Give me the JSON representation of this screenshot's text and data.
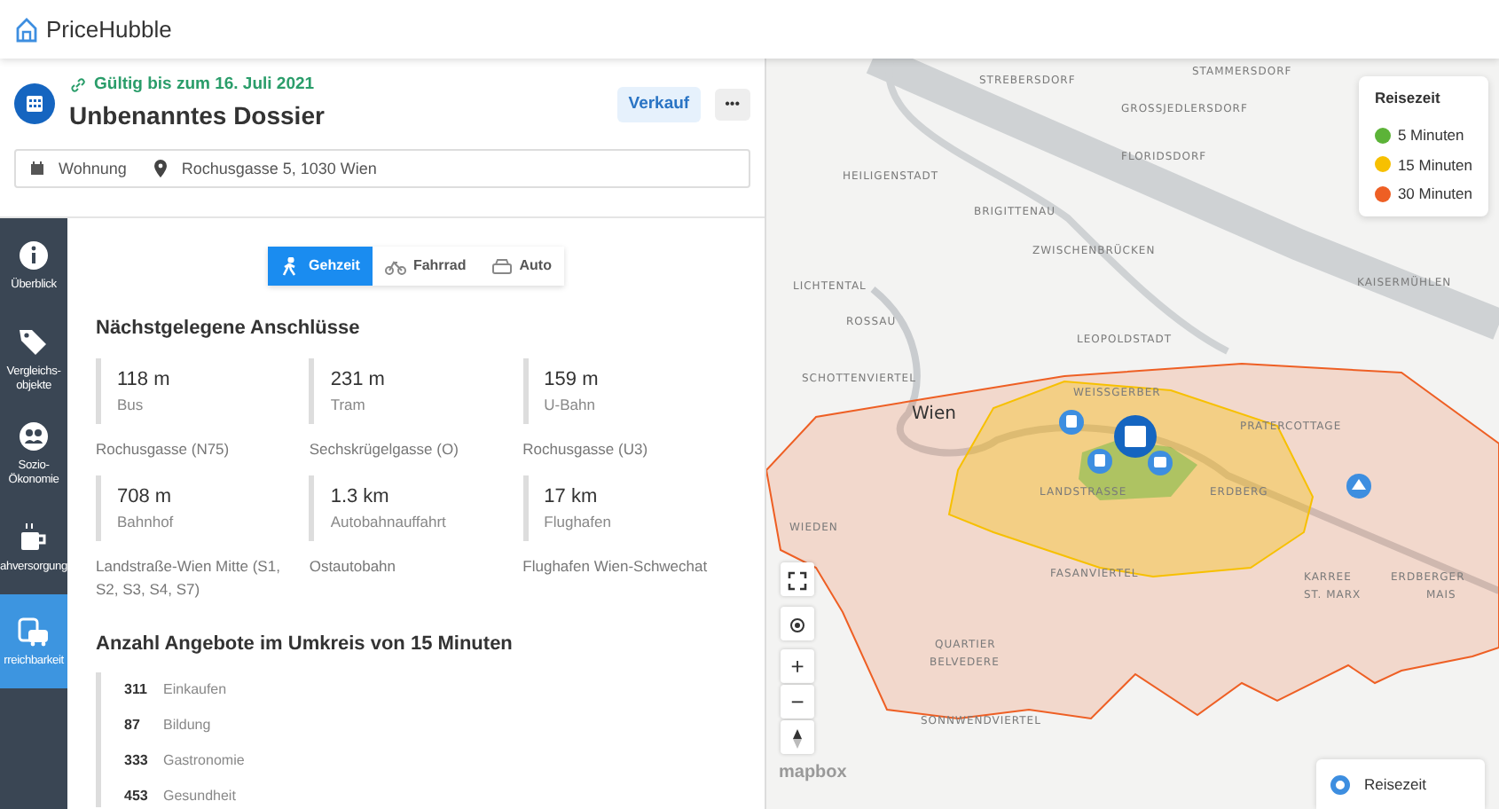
{
  "app": {
    "brand": "PriceHubble"
  },
  "dossier": {
    "validity": "Gültig bis zum 16. Juli 2021",
    "title": "Unbenanntes Dossier",
    "deal_type": "Verkauf",
    "more": "•••",
    "property_type": "Wohnung",
    "address": "Rochusgasse 5, 1030 Wien"
  },
  "sidebar": {
    "items": [
      {
        "kind": "info",
        "label": "Überblick",
        "selected": false
      },
      {
        "kind": "tags",
        "label": "Vergleichs-objekte",
        "selected": false
      },
      {
        "kind": "people",
        "label": "Sozio-Ökonomie",
        "selected": false
      },
      {
        "kind": "cup",
        "label": "ahversorgung",
        "selected": false
      },
      {
        "kind": "transit",
        "label": "rreichbarkeit",
        "selected": true
      }
    ]
  },
  "mode_tabs": [
    {
      "kind": "walk",
      "label": "Gehzeit",
      "selected": true
    },
    {
      "kind": "bike",
      "label": "Fahrrad",
      "selected": false
    },
    {
      "kind": "car",
      "label": "Auto",
      "selected": false
    }
  ],
  "connections": {
    "title": "Nächstgelegene Anschlüsse",
    "items": [
      {
        "distance": "118 m",
        "type": "Bus",
        "name": "Rochusgasse (N75)"
      },
      {
        "distance": "231 m",
        "type": "Tram",
        "name": "Sechskrügelgasse (O)"
      },
      {
        "distance": "159 m",
        "type": "U-Bahn",
        "name": "Rochusgasse (U3)"
      },
      {
        "distance": "708 m",
        "type": "Bahnhof",
        "name": "Landstraße-Wien Mitte (S1, S2, S3, S4, S7)"
      },
      {
        "distance": "1.3 km",
        "type": "Autobahnauffahrt",
        "name": "Ostautobahn"
      },
      {
        "distance": "17 km",
        "type": "Flughafen",
        "name": "Flughafen Wien-Schwechat"
      }
    ]
  },
  "offers": {
    "title": "Anzahl Angebote im Umkreis von 15 Minuten",
    "items": [
      {
        "count": "311",
        "label": "Einkaufen"
      },
      {
        "count": "87",
        "label": "Bildung"
      },
      {
        "count": "333",
        "label": "Gastronomie"
      },
      {
        "count": "453",
        "label": "Gesundheit"
      }
    ]
  },
  "map": {
    "labels": [
      "STAMMERSDORF",
      "STREBERSDORF",
      "GROSSJEDLERSDORF",
      "FLORIDSDORF",
      "HEILIGENSTADT",
      "BRIGITTENAU",
      "ZWISCHENBRÜCKEN",
      "LICHTENTAL",
      "ROSSAU",
      "KAISERMÜHLEN",
      "LEOPOLDSTADT",
      "SCHOTTENVIERTEL",
      "WEISSGERBER",
      "Wien",
      "PRATERCOTTAGE",
      "LANDSTRASSE",
      "ERDBERG",
      "WIEDEN",
      "FASANVIERTEL",
      "KARREE",
      "ERDBERGER",
      "ST. MARX",
      "MAIS",
      "QUARTIER",
      "BELVEDERE",
      "SONNWENDVIERTEL"
    ],
    "legend": {
      "title": "Reisezeit",
      "items": [
        {
          "label": "5 Minuten",
          "color": "#5cb338"
        },
        {
          "label": "15 Minuten",
          "color": "#f7c000"
        },
        {
          "label": "30 Minuten",
          "color": "#ee5f24"
        }
      ]
    },
    "zoom_in": "+",
    "zoom_out": "−",
    "attribution": "mapbox",
    "layer": {
      "label": "Reisezeit",
      "selected": true
    }
  }
}
